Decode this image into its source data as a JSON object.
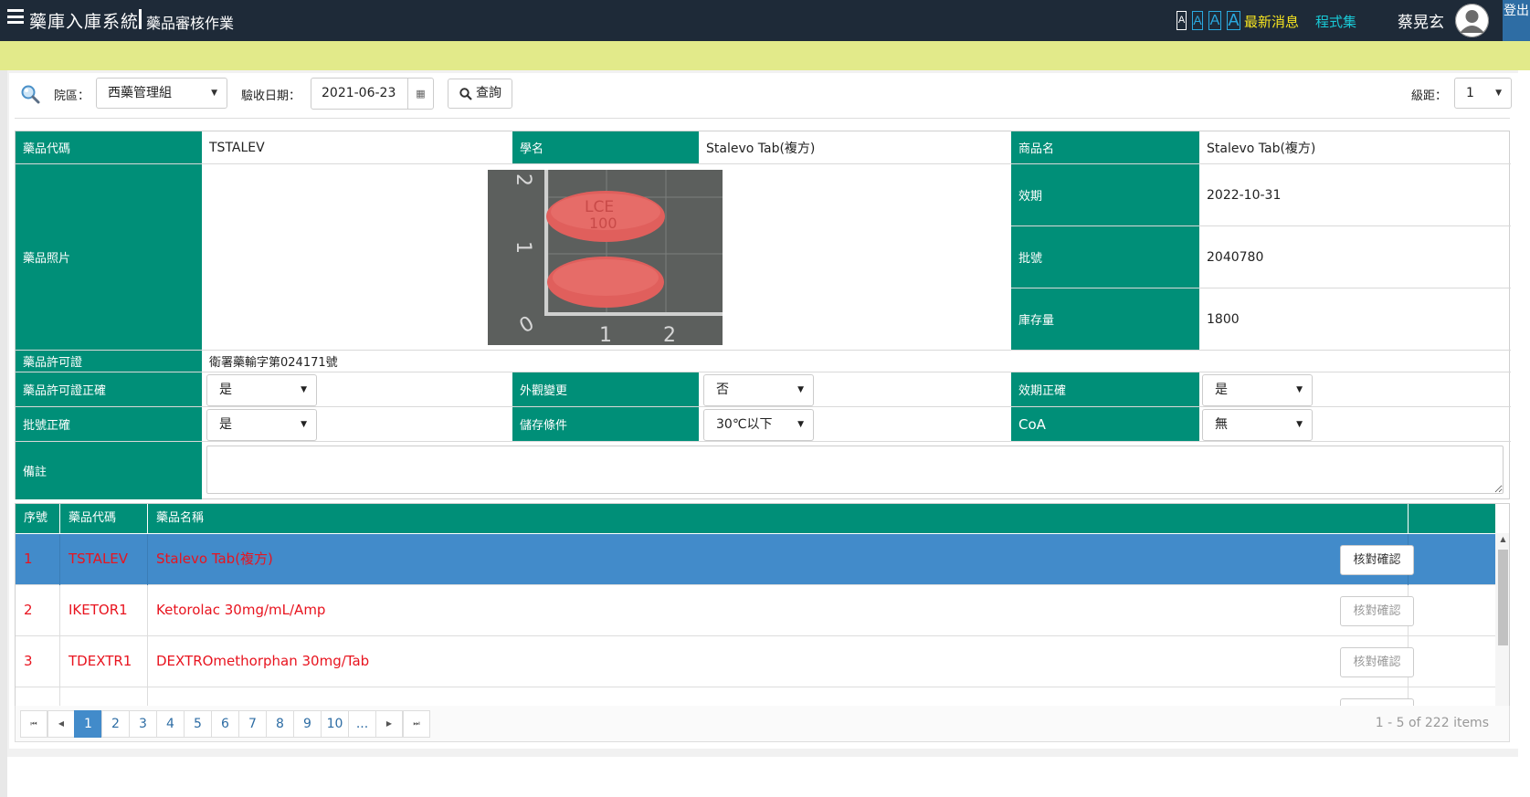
{
  "header": {
    "app_title": "藥庫入庫系統",
    "page_title": "藥品審核作業",
    "font_size_buttons": [
      "A",
      "A",
      "A",
      "A"
    ],
    "news": "最新消息",
    "programs": "程式集",
    "user": "蔡晃玄",
    "logout": "登出"
  },
  "filters": {
    "campus_label": "院區：",
    "campus_value": "西藥管理組",
    "date_label": "驗收日期：",
    "date_value": "2021-06-23",
    "query_button": "查詢",
    "level_label": "級距：",
    "level_value": "1"
  },
  "detail": {
    "code_label": "藥品代碼",
    "code_value": "TSTALEV",
    "generic_label": "學名",
    "generic_value": "Stalevo Tab(複方)",
    "brand_label": "商品名",
    "brand_value": "Stalevo Tab(複方)",
    "photo_label": "藥品照片",
    "photo_imprint_top": "LCE",
    "photo_imprint_bottom": "100",
    "ruler": [
      "2",
      "1",
      "0",
      "1",
      "2"
    ],
    "expiry_label": "效期",
    "expiry_value": "2022-10-31",
    "lot_label": "批號",
    "lot_value": "2040780",
    "stock_label": "庫存量",
    "stock_value": "1800",
    "license_label": "藥品許可證",
    "license_value": "衛署藥輸字第024171號",
    "license_ok_label": "藥品許可證正確",
    "license_ok_value": "是",
    "appearance_label": "外觀變更",
    "appearance_value": "否",
    "expiry_ok_label": "效期正確",
    "expiry_ok_value": "是",
    "lot_ok_label": "批號正確",
    "lot_ok_value": "是",
    "storage_label": "儲存條件",
    "storage_value": "30℃以下",
    "coa_label": "CoA",
    "coa_value": "無",
    "remark_label": "備註",
    "remark_value": ""
  },
  "grid": {
    "columns": [
      "序號",
      "藥品代碼",
      "藥品名稱",
      ""
    ],
    "rows": [
      {
        "no": "1",
        "code": "TSTALEV",
        "name": "Stalevo Tab(複方)",
        "action": "核對確認"
      },
      {
        "no": "2",
        "code": "IKETOR1",
        "name": "Ketorolac 30mg/mL/Amp",
        "action": "核對確認"
      },
      {
        "no": "3",
        "code": "TDEXTR1",
        "name": "DEXTROmethorphan 30mg/Tab",
        "action": "核對確認"
      }
    ]
  },
  "pager": {
    "pages": [
      "1",
      "2",
      "3",
      "4",
      "5",
      "6",
      "7",
      "8",
      "9",
      "10",
      "..."
    ],
    "first": "⏮",
    "prev": "◀",
    "next": "▶",
    "last": "⏭",
    "summary": "1 - 5 of 222 items",
    "current_page": 1
  }
}
